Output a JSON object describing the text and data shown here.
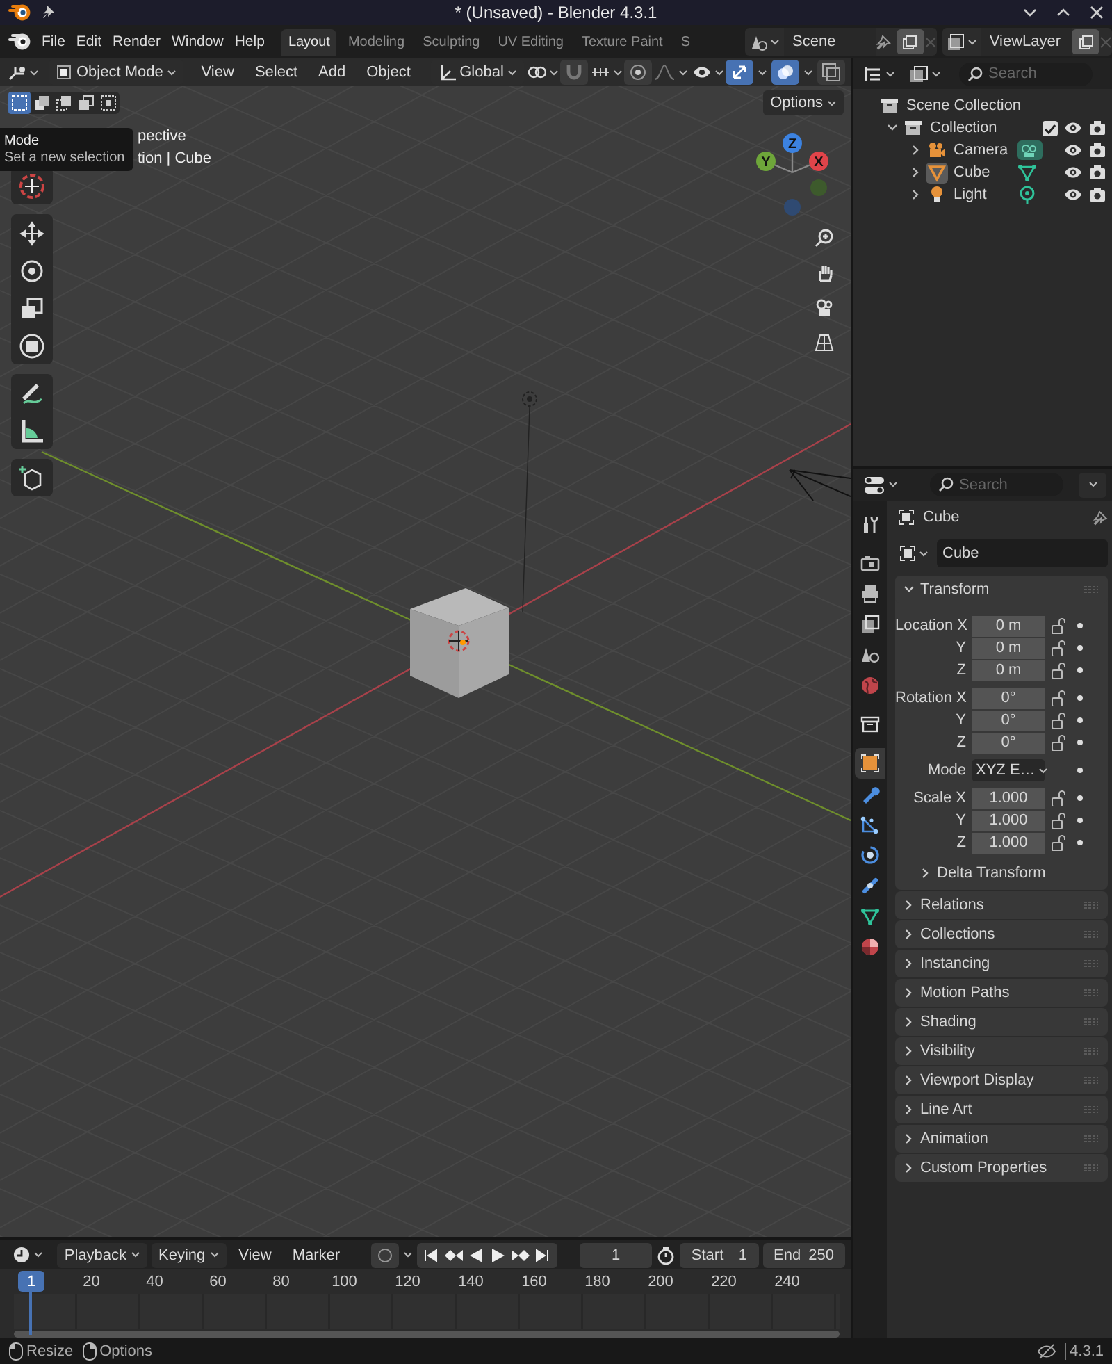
{
  "window": {
    "title": "* (Unsaved) - Blender 4.3.1"
  },
  "menu": [
    "File",
    "Edit",
    "Render",
    "Window",
    "Help"
  ],
  "workspace_tabs": [
    {
      "label": "Layout",
      "selected": true
    },
    {
      "label": "Modeling",
      "selected": false
    },
    {
      "label": "Sculpting",
      "selected": false
    },
    {
      "label": "UV Editing",
      "selected": false
    },
    {
      "label": "Texture Paint",
      "selected": false
    },
    {
      "label": "S",
      "selected": false
    }
  ],
  "scene": {
    "name": "Scene"
  },
  "view_layer": {
    "name": "ViewLayer"
  },
  "viewport": {
    "mode": "Object Mode",
    "menus": [
      "View",
      "Select",
      "Add",
      "Object"
    ],
    "orientation": "Global",
    "toggles": [
      {
        "kind": "snap",
        "on": false
      },
      {
        "kind": "proportional",
        "on": false
      },
      {
        "kind": "gizmos",
        "on": true
      },
      {
        "kind": "overlays",
        "on": true
      },
      {
        "kind": "xray",
        "on": false
      }
    ],
    "selection_modes": [
      {
        "selected": true
      },
      {
        "selected": false
      },
      {
        "selected": false
      },
      {
        "selected": false
      },
      {
        "selected": false
      }
    ],
    "options": "Options",
    "overlay_text": [
      "pective",
      "tion | Cube"
    ],
    "tooltip": {
      "title": "Mode",
      "description": "Set a new selection"
    },
    "axes": [
      "X",
      "Y",
      "Z"
    ]
  },
  "outliner": {
    "search_placeholder": "Search",
    "tree": [
      {
        "label": "Scene Collection",
        "kind": "scene_collection",
        "children": [
          {
            "label": "Collection",
            "kind": "collection",
            "expanded": true,
            "checked": true,
            "children": [
              {
                "label": "Camera",
                "kind": "camera",
                "expanded": false,
                "active": false
              },
              {
                "label": "Cube",
                "kind": "mesh",
                "expanded": false,
                "active": true
              },
              {
                "label": "Light",
                "kind": "light",
                "expanded": false,
                "active": false
              }
            ]
          }
        ]
      }
    ]
  },
  "properties": {
    "search_placeholder": "Search",
    "context": "Cube",
    "object_name": "Cube",
    "tabs": [
      {
        "kind": "tool",
        "selected": false
      },
      {
        "kind": "render",
        "selected": false
      },
      {
        "kind": "output",
        "selected": false
      },
      {
        "kind": "view_layer",
        "selected": false
      },
      {
        "kind": "scene",
        "selected": false
      },
      {
        "kind": "world",
        "selected": false
      },
      {
        "kind": "collection",
        "selected": false
      },
      {
        "kind": "object",
        "selected": true
      },
      {
        "kind": "modifiers",
        "selected": false
      },
      {
        "kind": "particles",
        "selected": false
      },
      {
        "kind": "physics",
        "selected": false
      },
      {
        "kind": "constraints",
        "selected": false
      },
      {
        "kind": "data",
        "selected": false
      },
      {
        "kind": "material",
        "selected": false
      }
    ],
    "panels": [
      {
        "label": "Transform",
        "expanded": true,
        "groups": [
          {
            "fields": [
              {
                "label": "Location X",
                "value": "0 m",
                "kind": "number"
              },
              {
                "label": "Y",
                "value": "0 m",
                "kind": "number"
              },
              {
                "label": "Z",
                "value": "0 m",
                "kind": "number"
              }
            ]
          },
          {
            "fields": [
              {
                "label": "Rotation X",
                "value": "0°",
                "kind": "number"
              },
              {
                "label": "Y",
                "value": "0°",
                "kind": "number"
              },
              {
                "label": "Z",
                "value": "0°",
                "kind": "number"
              }
            ]
          },
          {
            "fields": [
              {
                "label": "Mode",
                "value": "XYZ E…",
                "kind": "dropdown"
              }
            ]
          },
          {
            "fields": [
              {
                "label": "Scale X",
                "value": "1.000",
                "kind": "number"
              },
              {
                "label": "Y",
                "value": "1.000",
                "kind": "number"
              },
              {
                "label": "Z",
                "value": "1.000",
                "kind": "number"
              }
            ]
          }
        ],
        "subpanels": [
          {
            "label": "Delta Transform",
            "expanded": false
          }
        ]
      },
      {
        "label": "Relations",
        "expanded": false
      },
      {
        "label": "Collections",
        "expanded": false
      },
      {
        "label": "Instancing",
        "expanded": false
      },
      {
        "label": "Motion Paths",
        "expanded": false
      },
      {
        "label": "Shading",
        "expanded": false
      },
      {
        "label": "Visibility",
        "expanded": false
      },
      {
        "label": "Viewport Display",
        "expanded": false
      },
      {
        "label": "Line Art",
        "expanded": false
      },
      {
        "label": "Animation",
        "expanded": false
      },
      {
        "label": "Custom Properties",
        "expanded": false
      }
    ]
  },
  "timeline": {
    "menus": [
      "Playback",
      "Keying",
      "View",
      "Marker"
    ],
    "auto_key": {
      "on": false
    },
    "current_frame": "1",
    "start_label": "Start",
    "start": "1",
    "end_label": "End",
    "end": "250",
    "playhead": "1",
    "ruler": [
      "20",
      "40",
      "60",
      "80",
      "100",
      "120",
      "140",
      "160",
      "180",
      "200",
      "220",
      "240"
    ]
  },
  "status_bar": {
    "hints": [
      {
        "kind": "left_click",
        "label": "Resize"
      },
      {
        "kind": "right_click",
        "label": "Options"
      }
    ],
    "version": "4.3.1"
  }
}
